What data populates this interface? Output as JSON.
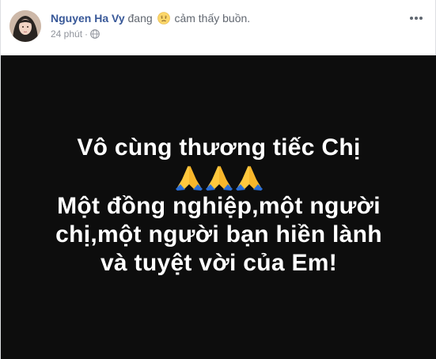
{
  "post": {
    "author": "Nguyen Ha Vy",
    "feeling_prefix": "đang",
    "feeling_icon": "sad-face-icon",
    "feeling_text": "cảm thấy buồn.",
    "timestamp": "24 phút",
    "separator": "·",
    "privacy_icon": "globe-icon",
    "more_icon": "more-horizontal-icon"
  },
  "status": {
    "background_color": "#0d0d0d",
    "text_color": "#ffffff",
    "line1": "Vô cùng thương tiếc Chị",
    "emoji": "folded-hands-icon",
    "emoji_count": 3,
    "line2": "Một đồng nghiệp,một người",
    "line3": "chị,một người bạn hiền lành",
    "line4": "và tuyệt vời của Em!"
  },
  "colors": {
    "author": "#385898",
    "meta": "#90949c"
  }
}
